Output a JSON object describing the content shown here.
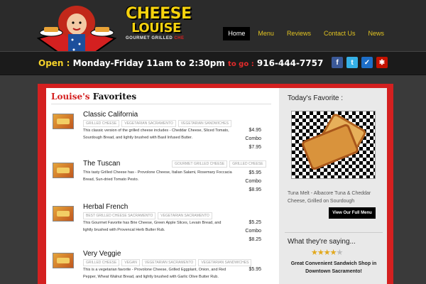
{
  "brand": {
    "logo_word_1": "CHEESE",
    "logo_word_2": "LOUISE",
    "logo_sub_1": "GOURMET GRILLED",
    "logo_sub_2": "CHE"
  },
  "nav": [
    "Home",
    "Menu",
    "Reviews",
    "Contact Us",
    "News"
  ],
  "open_bar": {
    "open_label": "Open :",
    "hours": "Monday-Friday 11am to 2:30pm",
    "togo_label": "to go :",
    "phone": "916-444-7757"
  },
  "social_icons": [
    {
      "name": "facebook-icon",
      "glyph": "f"
    },
    {
      "name": "twitter-icon",
      "glyph": "t"
    },
    {
      "name": "foursquare-icon",
      "glyph": "✓"
    },
    {
      "name": "yelp-icon",
      "glyph": "✱"
    }
  ],
  "favorites": {
    "heading_red": "Louise's",
    "heading": "Favorites",
    "items": [
      {
        "title": "Classic California",
        "tags": [
          "GRILLED CHEESE",
          "VEGETARIAN SACRAMENTO",
          "VEGETARIAN SANDWICHES"
        ],
        "desc": "This classic version of the grilled cheese includes - Cheddar Cheese, Sliced Tomato, Sourdough Bread, and lightly brushed with Basil Infused Butter.",
        "price": "$4.95",
        "combo_label": "Combo",
        "combo_price": "$7.95"
      },
      {
        "title": "The Tuscan",
        "tags": [
          "GOURMET GRILLED CHEESE",
          "GRILLED CHEESE"
        ],
        "desc": "This tasty Grilled Cheese has - Provolone Cheese, Italian Salami, Rosemary Foccacia Bread, Sun-dried Tomato Pesto.",
        "price": "$5.95",
        "combo_label": "Combo",
        "combo_price": "$8.95"
      },
      {
        "title": "Herbal French",
        "tags": [
          "BEST GRILLED CHEESE SACRAMENTO",
          "VEGETARIAN SACRAMENTO"
        ],
        "desc": "This Gourmet Favorite has Brie Cheese, Green Apple Slices, Levain Bread, and lightly brushed with Provencal Herb Butter Rub.",
        "price": "$5.25",
        "combo_label": "Combo",
        "combo_price": "$8.25"
      },
      {
        "title": "Very Veggie",
        "tags": [
          "GRILLED CHEESE",
          "VEGAN",
          "VEGETARIAN SACRAMENTO",
          "VEGETARIAN SANDWICHES"
        ],
        "desc": "This is a vegetarian favorite - Provolone Cheese, Grilled Eggplant, Onion, and Red Pepper, Wheat Walnut Bread, and lightly brushed with Garlic Olive Butter Rub.",
        "price": "$5.95",
        "combo_label": "",
        "combo_price": ""
      }
    ]
  },
  "sidebar": {
    "todays_favorite_title": "Today's Favorite :",
    "caption": "Tuna Melt - Albacore Tuna & Cheddar Cheese, Grilled on Sourdough",
    "menu_button": "View Our Full Menu",
    "saying_title": "What they're saying...",
    "rating": 4,
    "rating_max": 5,
    "review": "Great Convenient Sandwich Shop in Downtown Sacramento!"
  }
}
